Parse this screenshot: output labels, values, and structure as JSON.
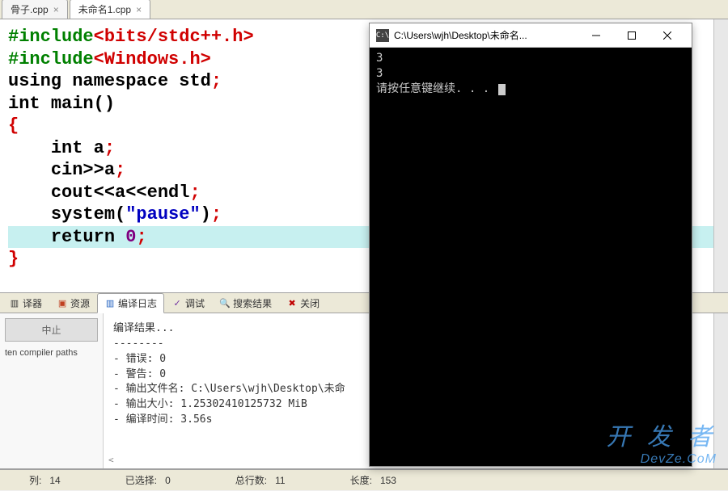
{
  "tabs": [
    {
      "label": "骨子.cpp"
    },
    {
      "label": "未命名1.cpp"
    }
  ],
  "code": {
    "l1_pre": "#include",
    "l1_ang": "<bits/stdc++.h>",
    "l2_pre": "#include",
    "l2_ang": "<Windows.h>",
    "l3_kw1": "using",
    "l3_kw2": "namespace",
    "l3_id": "std",
    "l3_p": ";",
    "l4_kw": "int",
    "l4_id": "main",
    "l4_par": "()",
    "l5": "{",
    "l6_kw": "int",
    "l6_id": "a",
    "l6_p": ";",
    "l7_a": "cin",
    "l7_b": ">>",
    "l7_c": "a",
    "l7_p": ";",
    "l8_a": "cout",
    "l8_b": "<<",
    "l8_c": "a",
    "l8_d": "<<",
    "l8_e": "endl",
    "l8_p": ";",
    "l9_a": "system",
    "l9_b": "(",
    "l9_c": "\"pause\"",
    "l9_d": ")",
    "l9_p": ";",
    "l10_a": "return",
    "l10_b": "0",
    "l10_p": ";"
  },
  "panel_tabs": {
    "compiler": "译器",
    "resources": "资源",
    "compile_log": "编译日志",
    "debug": "调试",
    "search": "搜索结果",
    "close": "关闭"
  },
  "panel": {
    "abort": "中止",
    "shorten": "ten compiler paths",
    "log_header": "编译结果...",
    "log_dashes": "--------",
    "log_errors": "- 错误: 0",
    "log_warnings": "- 警告: 0",
    "log_outfile": "- 输出文件名: C:\\Users\\wjh\\Desktop\\未命",
    "log_outsize": "- 输出大小: 1.25302410125732 MiB",
    "log_time": "- 编译时间: 3.56s",
    "scroll_hint": "<"
  },
  "status": {
    "col_label": "列:",
    "col_val": "14",
    "sel_label": "已选择:",
    "sel_val": "0",
    "lines_label": "总行数:",
    "lines_val": "11",
    "len_label": "长度:",
    "len_val": "153"
  },
  "console": {
    "title": "C:\\Users\\wjh\\Desktop\\未命名...",
    "line1": "3",
    "line2": "3",
    "line3": "请按任意键继续. . . "
  },
  "watermark": {
    "top": "开 发 者",
    "bottom": "DevZe.CoM"
  }
}
